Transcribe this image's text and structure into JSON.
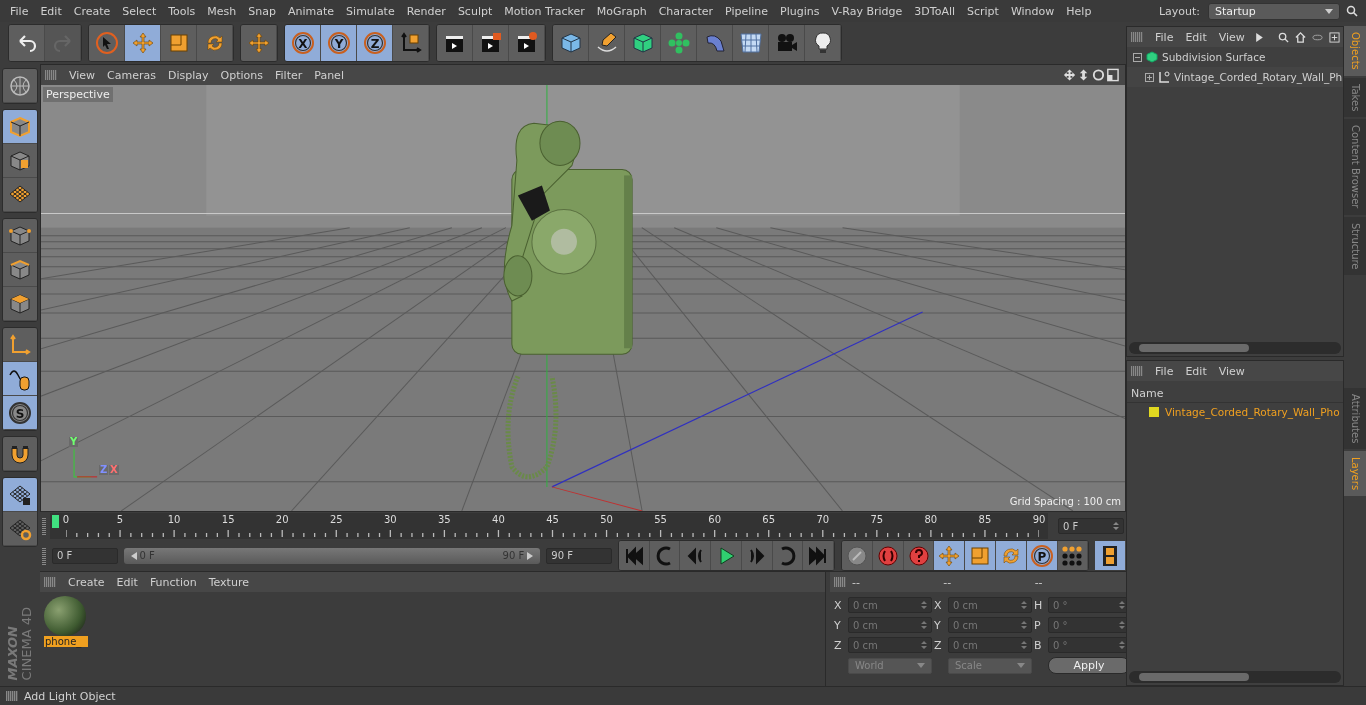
{
  "menu_bar": {
    "items": [
      "File",
      "Edit",
      "Create",
      "Select",
      "Tools",
      "Mesh",
      "Snap",
      "Animate",
      "Simulate",
      "Render",
      "Sculpt",
      "Motion Tracker",
      "MoGraph",
      "Character",
      "Pipeline",
      "Plugins",
      "V-Ray Bridge",
      "3DToAll",
      "Script",
      "Window",
      "Help"
    ],
    "layout_label": "Layout:",
    "layout_value": "Startup"
  },
  "toolbar": {
    "history": [
      {
        "kind": "undo",
        "disabled": false
      },
      {
        "kind": "redo",
        "disabled": true
      }
    ],
    "groups": [
      [
        {
          "kind": "select",
          "selected": false
        },
        {
          "kind": "move",
          "selected": true
        },
        {
          "kind": "scale",
          "selected": false
        },
        {
          "kind": "rotate",
          "selected": false
        }
      ],
      [
        {
          "kind": "move",
          "selected": false
        }
      ],
      [
        {
          "kind": "axis",
          "label": "X",
          "selected": true
        },
        {
          "kind": "axis",
          "label": "Y",
          "selected": true
        },
        {
          "kind": "axis",
          "label": "Z",
          "selected": true
        },
        {
          "kind": "coord",
          "selected": false
        }
      ],
      [
        {
          "kind": "clapper",
          "selected": false
        },
        {
          "kind": "clapper-play",
          "selected": false
        },
        {
          "kind": "clapper-gear",
          "selected": false
        }
      ],
      [
        {
          "kind": "cube",
          "selected": false
        },
        {
          "kind": "pen",
          "selected": false
        },
        {
          "kind": "subdiv",
          "selected": false
        },
        {
          "kind": "cloner",
          "selected": false
        },
        {
          "kind": "deformer",
          "selected": false
        },
        {
          "kind": "floor",
          "selected": false
        },
        {
          "kind": "camera",
          "selected": false
        },
        {
          "kind": "light",
          "selected": false
        }
      ]
    ]
  },
  "left_tools": [
    [
      {
        "kind": "globe",
        "selected": false
      }
    ],
    [
      {
        "kind": "model",
        "selected": true
      },
      {
        "kind": "texture",
        "selected": false
      },
      {
        "kind": "grid",
        "selected": false
      }
    ],
    [
      {
        "kind": "points",
        "selected": false
      },
      {
        "kind": "edges",
        "selected": false
      },
      {
        "kind": "polygons",
        "selected": false
      }
    ],
    [
      {
        "kind": "axis-l",
        "selected": false
      },
      {
        "kind": "mouse",
        "selected": true
      },
      {
        "kind": "snap",
        "label": "S",
        "selected": true
      }
    ],
    [
      {
        "kind": "magnet",
        "selected": false
      }
    ],
    [
      {
        "kind": "workplane-lock",
        "selected": true
      },
      {
        "kind": "workplane-sync",
        "selected": false
      }
    ]
  ],
  "logo": {
    "brand": "MAXON",
    "product": "CINEMA 4D"
  },
  "viewport": {
    "menus": [
      "View",
      "Cameras",
      "Display",
      "Options",
      "Filter",
      "Panel"
    ],
    "camera": "Perspective",
    "grid_spacing": "Grid Spacing : 100 cm",
    "axis_labels": [
      "Y",
      "Z",
      "X"
    ]
  },
  "timeline": {
    "ticks": [
      "0",
      "5",
      "10",
      "15",
      "20",
      "25",
      "30",
      "35",
      "40",
      "45",
      "50",
      "55",
      "60",
      "65",
      "70",
      "75",
      "80",
      "85",
      "90"
    ],
    "current_frame": "0 F"
  },
  "transport": {
    "start": "0 F",
    "range_start": "0 F",
    "range_end": "90 F",
    "end": "90 F",
    "buttons": [
      {
        "kind": "first"
      },
      {
        "kind": "prev-key"
      },
      {
        "kind": "prev-frame"
      },
      {
        "kind": "play"
      },
      {
        "kind": "next-frame"
      },
      {
        "kind": "next-key"
      },
      {
        "kind": "last"
      }
    ],
    "key_buttons": [
      {
        "kind": "record",
        "selected": false
      },
      {
        "kind": "autokey",
        "selected": false
      },
      {
        "kind": "help",
        "selected": false
      },
      {
        "kind": "move",
        "selected": true
      },
      {
        "kind": "scale",
        "selected": true
      },
      {
        "kind": "rotate",
        "selected": true
      },
      {
        "kind": "param",
        "label": "P",
        "selected": true
      },
      {
        "kind": "dots",
        "selected": false
      }
    ],
    "timeline_button": {
      "selected": true
    }
  },
  "materials": {
    "menus": [
      "Create",
      "Edit",
      "Function",
      "Texture"
    ],
    "items": [
      {
        "name": "phone_",
        "selected": true
      }
    ]
  },
  "coordinates": {
    "headers": [
      "--",
      "--",
      "--"
    ],
    "rows": [
      {
        "a": "X",
        "a_value": "0 cm",
        "b": "X",
        "b_value": "0 cm",
        "c": "H",
        "c_value": "0 °"
      },
      {
        "a": "Y",
        "a_value": "0 cm",
        "b": "Y",
        "b_value": "0 cm",
        "c": "P",
        "c_value": "0 °"
      },
      {
        "a": "Z",
        "a_value": "0 cm",
        "b": "Z",
        "b_value": "0 cm",
        "c": "B",
        "c_value": "0 °"
      }
    ],
    "space": "World",
    "mode": "Scale",
    "apply": "Apply"
  },
  "objects": {
    "menus": [
      "File",
      "Edit",
      "View"
    ],
    "tree": [
      {
        "name": "Subdivision Surface",
        "kind": "subdiv",
        "expanded": true,
        "children": [
          {
            "name": "Vintage_Corded_Rotary_Wall_Ph",
            "kind": "null",
            "expanded": false
          }
        ]
      }
    ]
  },
  "layers": {
    "menus": [
      "File",
      "Edit",
      "View"
    ],
    "column": "Name",
    "items": [
      {
        "name": "Vintage_Corded_Rotary_Wall_Pho",
        "color": "#e0d820"
      }
    ]
  },
  "side_tabs_top": [
    {
      "label": "Objects",
      "selected": true
    },
    {
      "label": "Takes",
      "selected": false
    },
    {
      "label": "Content Browser",
      "selected": false
    },
    {
      "label": "Structure",
      "selected": false
    }
  ],
  "side_tabs_bottom": [
    {
      "label": "Attributes",
      "selected": false
    },
    {
      "label": "Layers",
      "selected": true
    }
  ],
  "status_bar": {
    "text": "Add Light Object"
  }
}
